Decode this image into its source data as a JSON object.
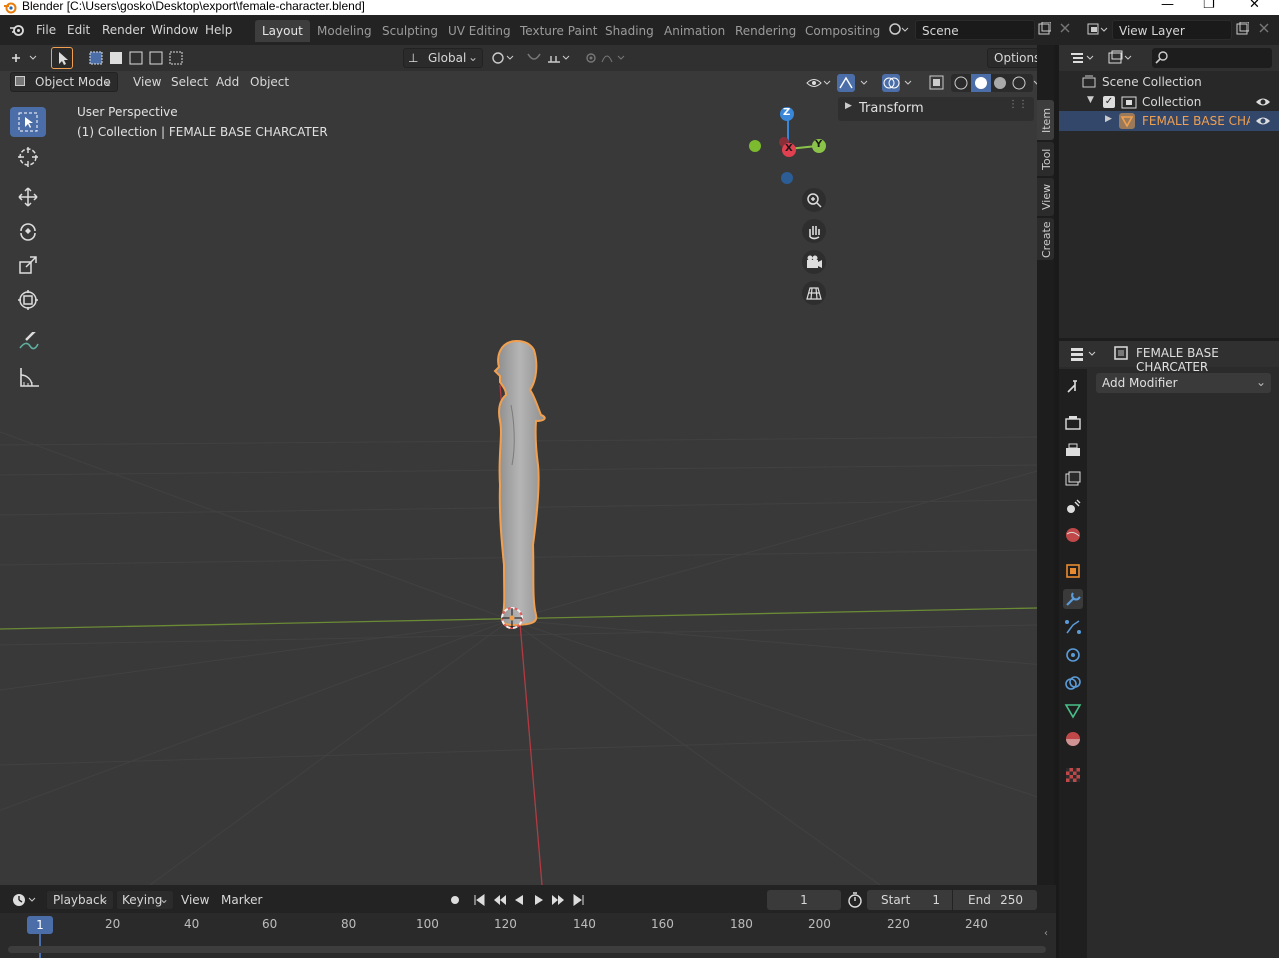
{
  "window": {
    "title": "Blender [C:\\Users\\gosko\\Desktop\\export\\female-character.blend]",
    "controls": [
      "—",
      "❐",
      "✕"
    ]
  },
  "menubar": {
    "items": [
      "File",
      "Edit",
      "Render",
      "Window",
      "Help"
    ]
  },
  "workspaces": {
    "tabs": [
      "Layout",
      "Modeling",
      "Sculpting",
      "UV Editing",
      "Texture Paint",
      "Shading",
      "Animation",
      "Rendering",
      "Compositing"
    ],
    "active": "Layout"
  },
  "scene": {
    "label": "Scene"
  },
  "view_layer": {
    "label": "View Layer"
  },
  "tool_header": {
    "orientation": "Global",
    "options": "Options"
  },
  "viewport_header": {
    "mode": "Object Mode",
    "menus": [
      "View",
      "Select",
      "Add",
      "Object"
    ]
  },
  "viewport": {
    "perspective_label": "User Perspective",
    "collection_label": "(1) Collection | FEMALE  BASE CHARCATER",
    "gizmo_axes": {
      "z": "Z",
      "y": "Y",
      "x": "X"
    },
    "npanel": {
      "transform_label": "Transform",
      "tabs": [
        "Item",
        "Tool",
        "View",
        "Create"
      ],
      "active_tab": "Item"
    }
  },
  "outliner": {
    "root": "Scene Collection",
    "collection": "Collection",
    "object": "FEMALE  BASE CHARC",
    "search_placeholder": ""
  },
  "properties": {
    "object_name": "FEMALE  BASE CHARCATER",
    "add_modifier": "Add Modifier",
    "active_tab": "modifiers"
  },
  "timeline": {
    "menus": [
      "Playback",
      "Keying",
      "View",
      "Marker"
    ],
    "current_frame": "1",
    "start_label": "Start",
    "start_value": "1",
    "end_label": "End",
    "end_value": "250",
    "ruler_ticks": [
      "1",
      "20",
      "40",
      "60",
      "80",
      "100",
      "120",
      "140",
      "160",
      "180",
      "200",
      "220",
      "240"
    ]
  },
  "colors": {
    "accent_blue": "#4c6ea8",
    "selection_orange": "#f0a050",
    "x_axis": "#e04050",
    "y_axis": "#8bc34a",
    "z_axis": "#3a86d8"
  }
}
